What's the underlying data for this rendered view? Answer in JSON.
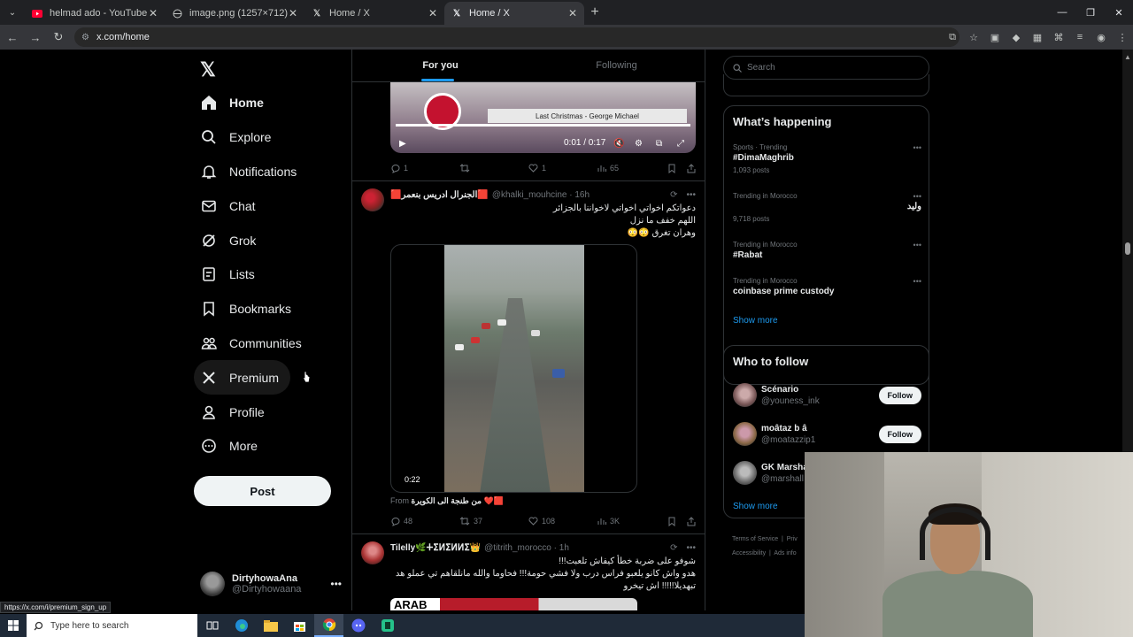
{
  "browser": {
    "tabs": [
      {
        "title": "helmad ado - YouTube",
        "favicon": "youtube-icon"
      },
      {
        "title": "image.png (1257×712)",
        "favicon": "globe-icon"
      },
      {
        "title": "Home / X",
        "favicon": "x-logo-icon"
      },
      {
        "title": "Home / X",
        "favicon": "x-logo-icon",
        "active": true
      }
    ],
    "url": "x.com/home",
    "status_url": "https://x.com/i/premium_sign_up"
  },
  "nav": {
    "items": [
      {
        "label": "Home",
        "icon": "home-icon"
      },
      {
        "label": "Explore",
        "icon": "search-icon"
      },
      {
        "label": "Notifications",
        "icon": "bell-icon"
      },
      {
        "label": "Chat",
        "icon": "mail-icon"
      },
      {
        "label": "Grok",
        "icon": "grok-icon"
      },
      {
        "label": "Lists",
        "icon": "list-icon"
      },
      {
        "label": "Bookmarks",
        "icon": "bookmark-icon"
      },
      {
        "label": "Communities",
        "icon": "communities-icon"
      },
      {
        "label": "Premium",
        "icon": "x-logo-icon"
      },
      {
        "label": "Profile",
        "icon": "person-icon"
      },
      {
        "label": "More",
        "icon": "more-circle-icon"
      }
    ],
    "post_label": "Post",
    "account": {
      "name": "DirtyhowaAna",
      "handle": "@Dirtyhowaana"
    }
  },
  "feed": {
    "tabs": [
      "For you",
      "Following"
    ],
    "tweet1": {
      "video_caption": "Last Christmas - George Michael",
      "video_time": "0:01 / 0:17",
      "replies": "1",
      "likes": "1",
      "views": "65"
    },
    "tweet2": {
      "name": "🟥الجنرال ادريس بنعمر🟥",
      "handle": "@khalki_mouhcine",
      "time": "16h",
      "line1": "دعواتكم اخواتي اخواتي لاخواننا بالجزائر",
      "line2": "اللهم خفف ما نزل",
      "line3": "وهران تغرق 😳😳",
      "video_duration": "0:22",
      "from_label": "From",
      "from_source": "من طنجة الى الكويرة ❤️🟥",
      "replies": "48",
      "retweets": "37",
      "likes": "108",
      "views": "3K"
    },
    "tweet3": {
      "name": "Tilelly🌿ⵜⵉⵍⵉⵍⵍⵉ👑",
      "handle": "@titrith_morocco",
      "time": "1h",
      "line1": "شوفو على ضربة خطأ كيفاش تلعبت!!!",
      "line2": "هدو واش كانو يلعبو فراس درب ولا فشي حومة!!! فحاوما والله مانلقاهم تي عملو هد",
      "line3": "تبهديلا!!!!! اش تيخرو",
      "thumb_text": "ARAB"
    }
  },
  "sidebar": {
    "search_placeholder": "Search",
    "happening_title": "What’s happening",
    "trends": [
      {
        "meta": "Sports · Trending",
        "title": "#DimaMaghrib",
        "count": "1,093 posts"
      },
      {
        "meta": "Trending in Morocco",
        "title": "وليد",
        "count": "9,718 posts"
      },
      {
        "meta": "Trending in Morocco",
        "title": "#Rabat",
        "count": ""
      },
      {
        "meta": "Trending in Morocco",
        "title": "coinbase prime custody",
        "count": ""
      }
    ],
    "show_more": "Show more",
    "wtf_title": "Who to follow",
    "follow": [
      {
        "name": "Scénario",
        "handle": "@youness_ink",
        "button": "Follow"
      },
      {
        "name": "moâtaz b â",
        "handle": "@moatazzip1",
        "button": "Follow"
      },
      {
        "name": "GK Marsha",
        "handle": "@marshall"
      }
    ],
    "show_more2": "Show more",
    "footer": {
      "terms": "Terms of Service",
      "privacy": "Priv",
      "accessibility": "Accessibility",
      "ads": "Ads info"
    }
  },
  "taskbar": {
    "search_placeholder": "Type here to search"
  },
  "colors": {
    "accent": "#1d9bf0",
    "background": "#000000",
    "text": "#e7e9ea",
    "muted": "#71767b"
  }
}
